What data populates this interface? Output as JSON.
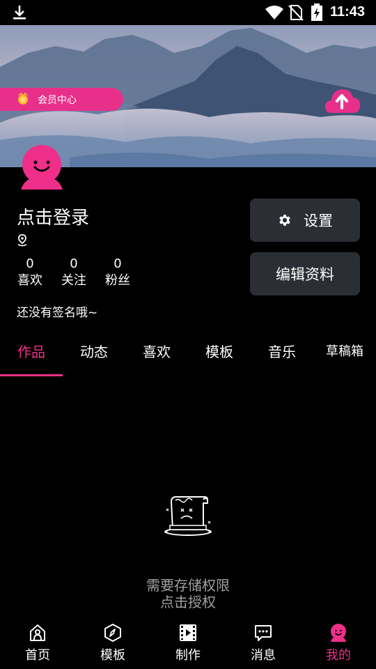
{
  "status_bar": {
    "time": "11:43"
  },
  "banner": {
    "member_label": "会员中心"
  },
  "profile": {
    "login_title": "点击登录",
    "stats": [
      {
        "value": "0",
        "label": "喜欢"
      },
      {
        "value": "0",
        "label": "关注"
      },
      {
        "value": "0",
        "label": "粉丝"
      }
    ],
    "signature": "还没有签名哦~"
  },
  "buttons": {
    "settings": "设置",
    "edit_profile": "编辑资料"
  },
  "tabs": [
    {
      "label": "作品",
      "active": true
    },
    {
      "label": "动态"
    },
    {
      "label": "喜欢"
    },
    {
      "label": "模板"
    },
    {
      "label": "音乐"
    },
    {
      "label": "草稿箱"
    }
  ],
  "empty_state": {
    "line1": "需要存储权限",
    "line2": "点击授权"
  },
  "bottom_nav": [
    {
      "label": "首页",
      "icon": "home-icon"
    },
    {
      "label": "模板",
      "icon": "compass-icon"
    },
    {
      "label": "制作",
      "icon": "film-icon"
    },
    {
      "label": "消息",
      "icon": "message-icon"
    },
    {
      "label": "我的",
      "icon": "profile-icon",
      "active": true
    }
  ],
  "colors": {
    "accent": "#ef2f8a",
    "button_bg": "#2b2f35",
    "background": "#000000",
    "muted_text": "#a0a0a0"
  }
}
